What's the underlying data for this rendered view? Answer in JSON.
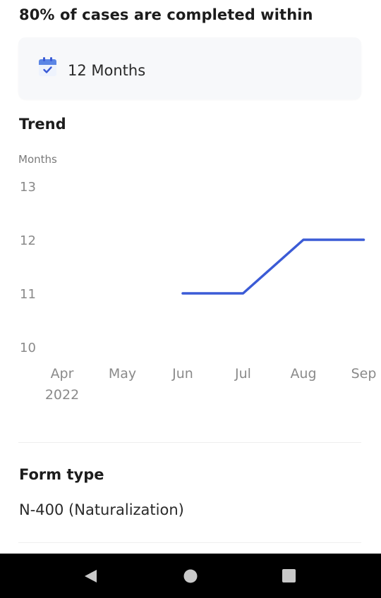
{
  "headline": "80% of cases are completed within",
  "duration": {
    "icon": "calendar-icon",
    "text": "12 Months"
  },
  "trend": {
    "title": "Trend"
  },
  "chart_data": {
    "type": "line",
    "ylabel": "Months",
    "ylim": [
      10,
      13
    ],
    "y_ticks": [
      "13",
      "12",
      "11",
      "10"
    ],
    "categories": [
      "Apr",
      "May",
      "Jun",
      "Jul",
      "Aug",
      "Sep"
    ],
    "x_tick_sublabels": [
      "2022",
      "",
      "",
      "",
      "",
      ""
    ],
    "series": [
      {
        "color": "#3b5bd6",
        "values": [
          null,
          null,
          11,
          11,
          12,
          12
        ]
      }
    ],
    "grid": false,
    "legend": "none"
  },
  "form": {
    "title": "Form type",
    "value": "N-400 (Naturalization)"
  },
  "colors": {
    "accent": "#3b5bd6",
    "icon_blue": "#5b86e5",
    "card_bg": "#f7f8fa"
  },
  "navigation": {
    "back_icon": "back-triangle-icon",
    "home_icon": "home-circle-icon",
    "recents_icon": "recents-square-icon"
  }
}
